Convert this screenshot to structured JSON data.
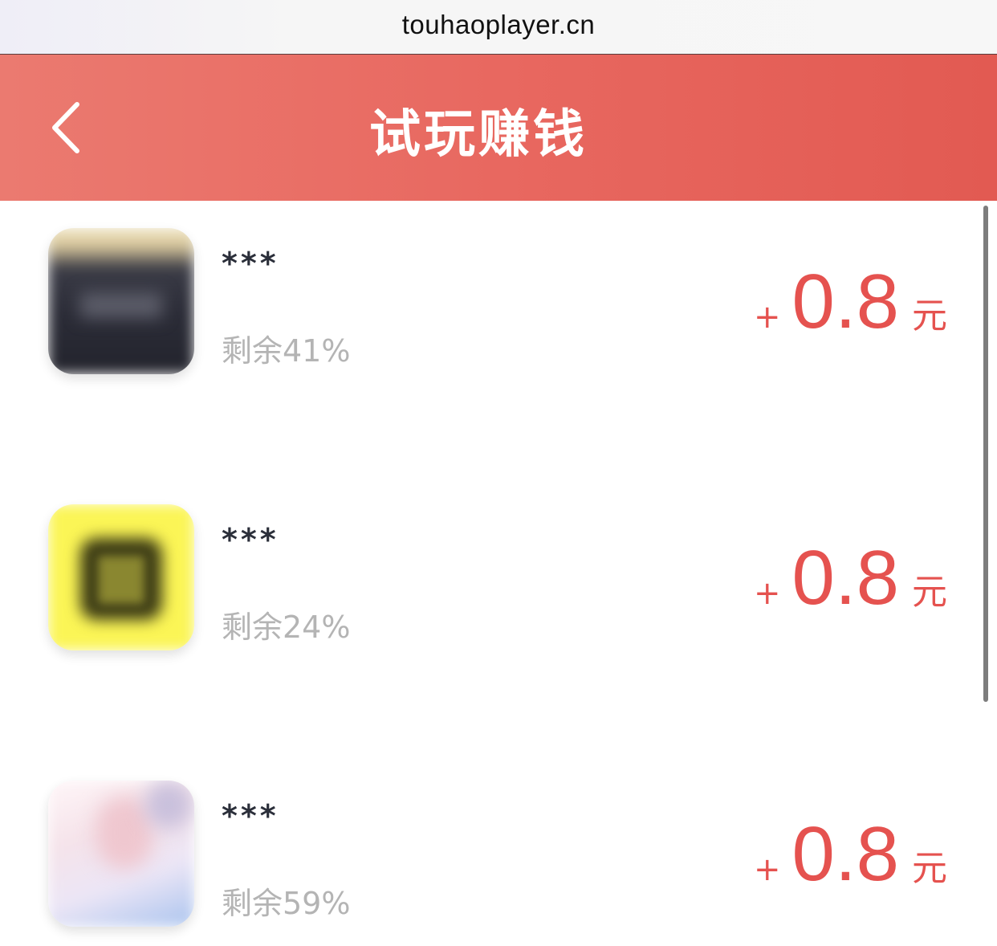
{
  "browser": {
    "url": "touhaoplayer.cn"
  },
  "header": {
    "title": "试玩赚钱",
    "back_icon": "chevron-left-icon"
  },
  "tasks": [
    {
      "name": "***",
      "remaining": "剩余41%",
      "reward_plus": "+",
      "reward_amount": "0.8",
      "reward_unit": "元",
      "icon_colors": [
        "#e8d6a8",
        "#2a2b36"
      ]
    },
    {
      "name": "***",
      "remaining": "剩余24%",
      "reward_plus": "+",
      "reward_amount": "0.8",
      "reward_unit": "元",
      "icon_colors": [
        "#fbf556",
        "#3b3a15"
      ]
    },
    {
      "name": "***",
      "remaining": "剩余59%",
      "reward_plus": "+",
      "reward_amount": "0.8",
      "reward_unit": "元",
      "icon_colors": [
        "#f7eaf0",
        "#a9c3ee"
      ]
    }
  ],
  "colors": {
    "header_red": "#e86860",
    "reward_red": "#e5524f",
    "muted_gray": "#b4b4b4"
  }
}
